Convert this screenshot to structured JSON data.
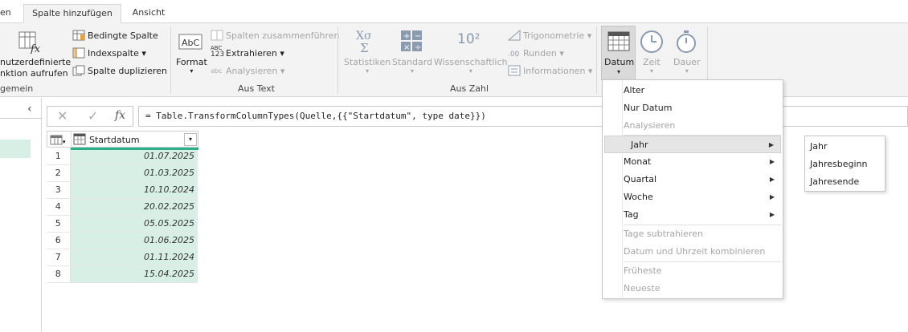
{
  "tabs": {
    "t0": "en",
    "t1": "Spalte hinzufügen",
    "t2": "Ansicht"
  },
  "ribbon": {
    "custom_fn": {
      "l1": "nutzerdefinierte",
      "l2": "nktion aufrufen",
      "group": "gemein"
    },
    "cond_col": "Bedingte Spalte",
    "index_col": "Indexspalte",
    "dup_col": "Spalte duplizieren",
    "format": "Format",
    "merge": "Spalten zusammenführen",
    "extract": "Extrahieren",
    "parse": "Analysieren",
    "group_text": "Aus Text",
    "stats": "Statistiken",
    "standard": "Standard",
    "scientific": "Wissenschaftlich",
    "trig": "Trigonometrie",
    "round": "Runden",
    "info": "Informationen",
    "group_number": "Aus Zahl",
    "date": "Datum",
    "time": "Zeit",
    "duration": "Dauer",
    "icon_sci": "10²",
    "icon_abc": "ABC",
    "icon_123": "123",
    "icon_fx": "fx"
  },
  "formula": {
    "fx": "fx",
    "text": "= Table.TransformColumnTypes(Quelle,{{\"Startdatum\", type date}})"
  },
  "grid": {
    "header": "Startdatum",
    "rows": [
      {
        "n": "1",
        "v": "01.07.2025"
      },
      {
        "n": "2",
        "v": "01.03.2025"
      },
      {
        "n": "3",
        "v": "10.10.2024"
      },
      {
        "n": "4",
        "v": "20.02.2025"
      },
      {
        "n": "5",
        "v": "05.05.2025"
      },
      {
        "n": "6",
        "v": "01.06.2025"
      },
      {
        "n": "7",
        "v": "01.11.2024"
      },
      {
        "n": "8",
        "v": "15.04.2025"
      }
    ]
  },
  "menu": {
    "age": "Alter",
    "date_only": "Nur Datum",
    "parse": "Analysieren",
    "year": "Jahr",
    "month": "Monat",
    "quarter": "Quartal",
    "week": "Woche",
    "day": "Tag",
    "subtract": "Tage subtrahieren",
    "combine": "Datum und Uhrzeit kombinieren",
    "earliest": "Früheste",
    "latest": "Neueste"
  },
  "submenu": {
    "year": "Jahr",
    "start": "Jahresbeginn",
    "end": "Jahresende"
  }
}
